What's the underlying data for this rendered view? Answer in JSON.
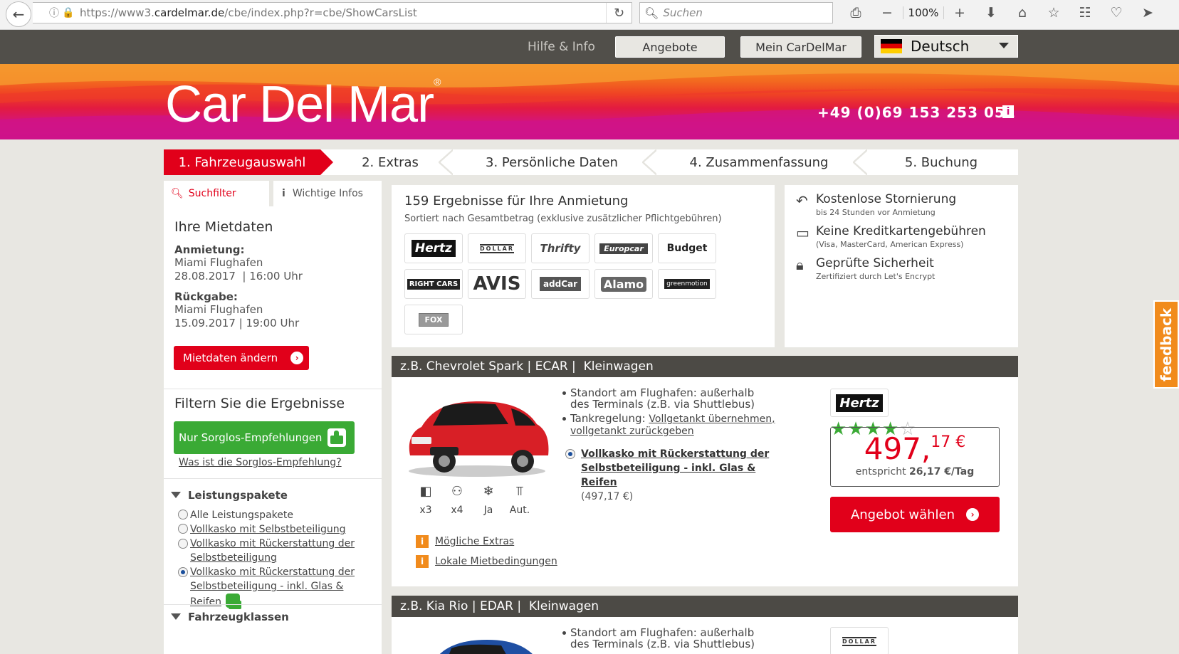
{
  "browser": {
    "url_prefix": "https://www3.",
    "url_domain": "cardelmar.de",
    "url_path": "/cbe/index.php?r=cbe/ShowCarsList",
    "search_placeholder": "Suchen",
    "zoom": "100%"
  },
  "topbar": {
    "help": "Hilfe & Info",
    "offers": "Angebote",
    "account": "Mein CarDelMar",
    "language": "Deutsch"
  },
  "banner": {
    "logo": "CarDelMar",
    "phone": "+49 (0)69 153 253 051"
  },
  "steps": [
    {
      "label": "1. Fahrzeugauswahl"
    },
    {
      "label": "2. Extras"
    },
    {
      "label": "3. Persönliche Daten"
    },
    {
      "label": "4. Zusammenfassung"
    },
    {
      "label": "5. Buchung"
    }
  ],
  "sidebar": {
    "tab_filter": "Suchfilter",
    "tab_info": "Wichtige Infos",
    "rental_title": "Ihre Mietdaten",
    "pickup_label": "Anmietung:",
    "pickup_place": "Miami Flughafen",
    "pickup_date": "28.08.2017  | 16:00 Uhr",
    "return_label": "Rückgabe:",
    "return_place": "Miami Flughafen",
    "return_date": "15.09.2017 | 19:00 Uhr",
    "change_button": "Mietdaten ändern",
    "filter_title": "Filtern Sie die Ergebnisse",
    "sorglos_button": "Nur Sorglos-Empfehlungen",
    "sorglos_link": "Was ist die Sorglos-Empfehlung?",
    "packages_title": "Leistungspakete",
    "packages": [
      {
        "label": "Alle Leistungspakete",
        "link": false
      },
      {
        "label": "Vollkasko mit Selbstbeteiligung",
        "link": true
      },
      {
        "label": "Vollkasko mit Rückerstattung der Selbstbeteiligung",
        "link": true
      },
      {
        "label": "Vollkasko mit Rückerstattung der Selbstbeteiligung - inkl. Glas & Reifen",
        "link": true
      }
    ],
    "vehicle_classes_title": "Fahrzeugklassen"
  },
  "results": {
    "title": "159 Ergebnisse für Ihre Anmietung",
    "subtitle": "Sortiert nach Gesamtbetrag (exklusive zusätzlicher Pflichtgebühren)",
    "suppliers": [
      "Hertz",
      "DOLLAR",
      "Thrifty",
      "Europcar",
      "Budget",
      "RIGHT CARS",
      "AVIS",
      "addCar",
      "Alamo",
      "greenmotion",
      "FOX"
    ]
  },
  "benefits": [
    {
      "title": "Kostenlose Stornierung",
      "sub": "bis 24 Stunden vor Anmietung"
    },
    {
      "title": "Keine Kreditkartengebühren",
      "sub": "(Visa, MasterCard, American Express)"
    },
    {
      "title": "Geprüfte Sicherheit",
      "sub": "Zertifiziert durch Let's Encrypt"
    }
  ],
  "cars": [
    {
      "header": "z.B. Chevrolet Spark | ECAR |  Kleinwagen",
      "feature_location": "Standort am Flughafen: außerhalb des Terminals (z.B. via Shuttlebus)",
      "feature_fuel_label": "Tankregelung: ",
      "feature_fuel_link": "Vollgetankt übernehmen, vollgetankt zurückgeben",
      "insurance": "Vollkasko mit Rückerstattung der Selbstbeteiligung - inkl. Glas & Reifen",
      "insurance_price": "(497,17 €)",
      "specs": [
        "x3",
        "x4",
        "Ja",
        "Aut."
      ],
      "extras_link": "Mögliche Extras",
      "terms_link": "Lokale Mietbedingungen",
      "supplier": "Hertz",
      "rating": 4,
      "price_main": "497,",
      "price_cents": "17 €",
      "per_day_label": "entspricht ",
      "per_day": "26,17 €/Tag",
      "select_button": "Angebot wählen",
      "color": "#d81f26"
    },
    {
      "header": "z.B. Kia Rio | EDAR |  Kleinwagen",
      "feature_location": "Standort am Flughafen: außerhalb des Terminals (z.B. via Shuttlebus)",
      "supplier": "DOLLAR",
      "color": "#1f4fa3"
    }
  ],
  "feedback": "feedback",
  "colors": {
    "brand_red": "#e1001a",
    "green": "#3aaa35",
    "dark": "#4c4a45",
    "orange": "#f18b1c"
  }
}
